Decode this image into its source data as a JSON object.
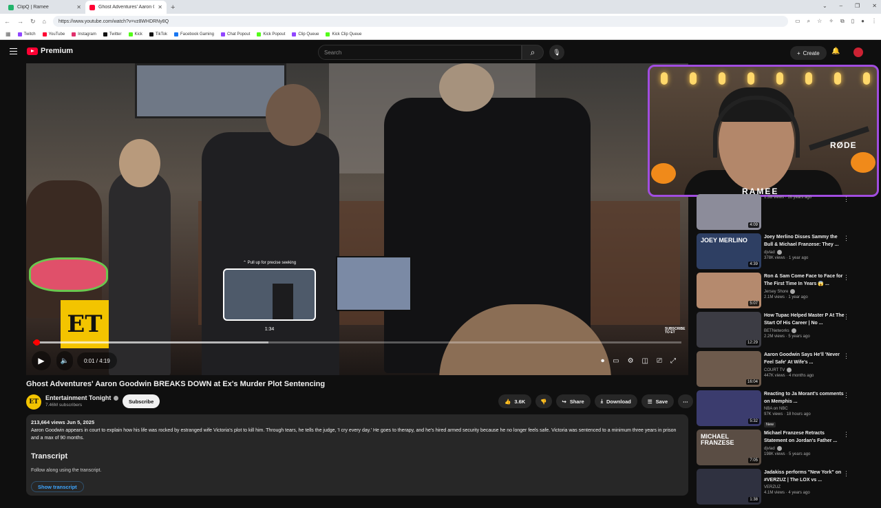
{
  "browser": {
    "tabs": [
      {
        "label": "ClipQ | Ramee",
        "color": "#23b46b",
        "active": false
      },
      {
        "label": "Ghost Adventures' Aaron Goo",
        "color": "#ff0033",
        "active": true
      }
    ],
    "url": "https://www.youtube.com/watch?v=vz8WHDRNy8Q",
    "bookmarks": [
      {
        "label": "Twitch",
        "color": "#9146ff"
      },
      {
        "label": "YouTube",
        "color": "#ff0033"
      },
      {
        "label": "Instagram",
        "color": "#e1306c"
      },
      {
        "label": "Twitter",
        "color": "#111111"
      },
      {
        "label": "Kick",
        "color": "#53fc18"
      },
      {
        "label": "TikTok",
        "color": "#111111"
      },
      {
        "label": "Facebook Gaming",
        "color": "#1877f2"
      },
      {
        "label": "Chat Popout",
        "color": "#9146ff"
      },
      {
        "label": "Kick Popout",
        "color": "#53fc18"
      },
      {
        "label": "Clip Queue",
        "color": "#9146ff"
      },
      {
        "label": "Kick Clip Queue",
        "color": "#53fc18"
      }
    ]
  },
  "header": {
    "logo": "Premium",
    "search_placeholder": "Search",
    "create_label": "Create"
  },
  "player": {
    "preview_hint": "Pull up for precise seeking",
    "preview_time": "1:34",
    "time_display": "0:01 / 4:19",
    "progress_fraction": 0.004,
    "hover_fraction": 0.363,
    "et_logo": "ET",
    "subscribe_mark": "SUBSCRIBE TO ET"
  },
  "facecam": {
    "brand": "RAMEE",
    "mic_brand": "RØDE"
  },
  "video": {
    "title": "Ghost Adventures' Aaron Goodwin BREAKS DOWN at Ex's Murder Plot Sentencing",
    "channel": "Entertainment Tonight",
    "channel_initials": "ET",
    "subscribers": "7.46M subscribers",
    "subscribe_label": "Subscribe",
    "likes": "3.6K",
    "share_label": "Share",
    "download_label": "Download",
    "save_label": "Save"
  },
  "description": {
    "meta": "213,664 views  Jun 5, 2025",
    "text": "Aaron Goodwin appears in court to explain how his life was rocked by estranged wife Victoria's plot to kill him. Through tears, he tells the judge, 'I cry every day.' He goes to therapy, and he's hired armed security because he no longer feels safe. Victoria was sentenced to a minimum three years in prison and a max of 90 months.",
    "transcript_heading": "Transcript",
    "transcript_sub": "Follow along using the transcript.",
    "transcript_button": "Show transcript"
  },
  "recommendations": [
    {
      "title": "",
      "channel": "",
      "meta": "1.3B views · 16 years ago",
      "duration": "4:09",
      "thumb": "#8c8c9a",
      "thumb_text": "",
      "verified": false,
      "badge": ""
    },
    {
      "title": "Joey Merlino Disses Sammy the Bull & Michael Franzese: They ...",
      "channel": "djvlad",
      "meta": "378K views · 1 year ago",
      "duration": "4:39",
      "thumb": "#2e3f63",
      "thumb_text": "JOEY MERLINO",
      "verified": true,
      "badge": ""
    },
    {
      "title": "Ron & Sam Come Face to Face for The First Time In Years 😱 ...",
      "channel": "Jersey Shore",
      "meta": "2.1M views · 1 year ago",
      "duration": "5:07",
      "thumb": "#b58a6e",
      "thumb_text": "",
      "verified": true,
      "badge": ""
    },
    {
      "title": "How Tupac Helped Master P At The Start Of His Career | No ...",
      "channel": "BETNetworks",
      "meta": "2.2M views · 5 years ago",
      "duration": "12:29",
      "thumb": "#3c3c44",
      "thumb_text": "",
      "verified": true,
      "badge": ""
    },
    {
      "title": "Aaron Goodwin Says He'll 'Never Feel Safe' At Wife's ...",
      "channel": "COURT TV",
      "meta": "447K views · 4 months ago",
      "duration": "16:04",
      "thumb": "#6d5a4c",
      "thumb_text": "",
      "verified": true,
      "badge": ""
    },
    {
      "title": "Reacting to Ja Morant's comments on Memphis ...",
      "channel": "NBA on NBC",
      "meta": "97K views · 18 hours ago",
      "duration": "5:32",
      "thumb": "#3b3c6e",
      "thumb_text": "",
      "verified": false,
      "badge": "New"
    },
    {
      "title": "Michael Franzese Retracts Statement on Jordan's Father ...",
      "channel": "djvlad",
      "meta": "198K views · 5 years ago",
      "duration": "7:05",
      "thumb": "#5a4d44",
      "thumb_text": "MICHAEL FRANZESE",
      "verified": true,
      "badge": ""
    },
    {
      "title": "Jadakiss performs \"New York\" on #VERZUZ | The LOX vs ...",
      "channel": "VERZUZ",
      "meta": "4.1M views · 4 years ago",
      "duration": "1:38",
      "thumb": "#2f3140",
      "thumb_text": "",
      "verified": false,
      "badge": ""
    }
  ],
  "colors": {
    "accent": "#ff0033",
    "link": "#3ea6ff",
    "frame": "#a14de0"
  }
}
